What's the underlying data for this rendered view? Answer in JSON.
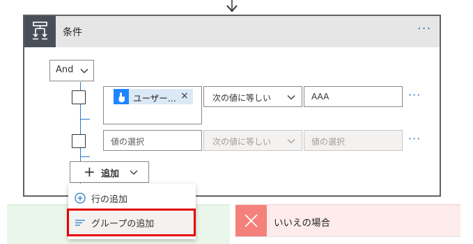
{
  "condition": {
    "title": "条件",
    "more": "···",
    "operator_group": "And",
    "rows": [
      {
        "token_label": "ユーザー...",
        "token_close": "×",
        "operator": "次の値に等しい",
        "value": "AAA",
        "more": "···"
      },
      {
        "left_placeholder": "値の選択",
        "operator": "次の値に等しい",
        "value_placeholder": "値の選択",
        "more": "···"
      }
    ],
    "add_button": {
      "plus": "+",
      "label": "追加"
    }
  },
  "add_menu": {
    "items": [
      {
        "label": "行の追加",
        "icon": "plus-circle-icon"
      },
      {
        "label": "グループの追加",
        "icon": "group-lines-icon"
      }
    ]
  },
  "branches": {
    "no_title": "いいえの場合"
  },
  "colors": {
    "accent": "#2b78c5",
    "header_icon_bg": "#484f58",
    "highlight_border": "#e50000",
    "no_branch_icon": "#f4817b"
  }
}
